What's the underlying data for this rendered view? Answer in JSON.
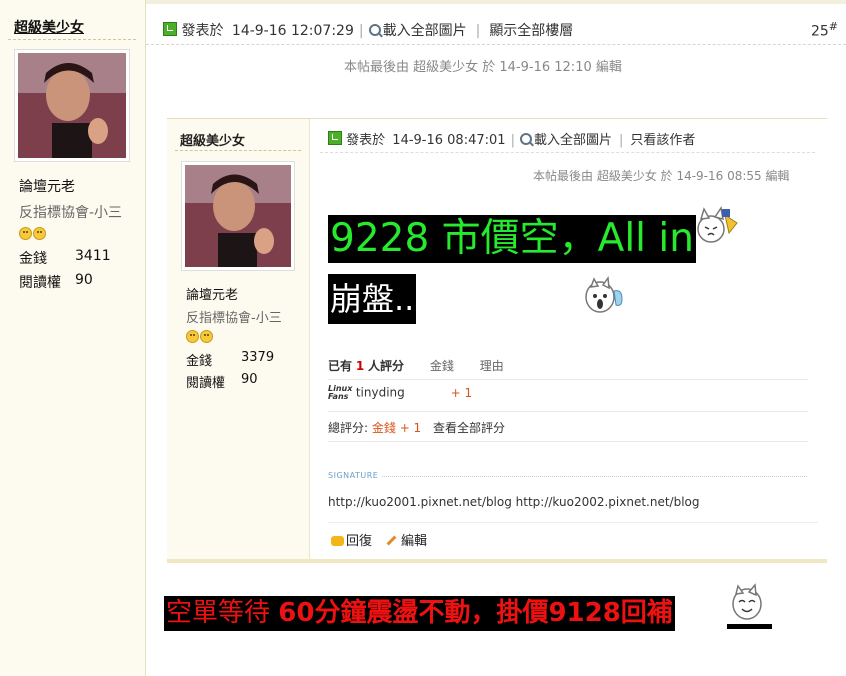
{
  "outer_user": {
    "username": "超級美少女",
    "rank": "論壇元老",
    "title": "反指標協會-小三",
    "stats": [
      {
        "label": "金錢",
        "value": "3411"
      },
      {
        "label": "閱讀權",
        "value": "90"
      }
    ]
  },
  "outer_post": {
    "posted_label": "發表於",
    "posted_time": "14-9-16 12:07:29",
    "load_images": "載入全部圖片",
    "show_all_floors": "顯示全部樓層",
    "floor_num": "25",
    "floor_mark": "#",
    "edit_note": "本帖最後由 超級美少女 於 14-9-16 12:10 編輯",
    "bottom_text_a": "空單等待 ",
    "bottom_text_b": "60分鐘震盪不動，掛價9128回補"
  },
  "inner_user": {
    "username": "超級美少女",
    "rank": "論壇元老",
    "title": "反指標協會-小三",
    "stats": [
      {
        "label": "金錢",
        "value": "3379"
      },
      {
        "label": "閱讀權",
        "value": "90"
      }
    ]
  },
  "inner_post": {
    "posted_label": "發表於",
    "posted_time": "14-9-16 08:47:01",
    "load_images": "載入全部圖片",
    "only_author": "只看該作者",
    "edit_note": "本帖最後由 超級美少女 於 14-9-16 08:55 編輯",
    "line1": "9228 市價空，All in",
    "line2": "崩盤..",
    "rating": {
      "header_prefix": "已有",
      "count": "1",
      "header_suffix": "人評分",
      "col_money": "金錢",
      "col_reason": "理由",
      "rater_badge_1": "Linux",
      "rater_badge_2": "Fans",
      "rater": "tinyding",
      "rater_value": "+ 1",
      "total_label": "總評分:",
      "total_value": "金錢 + 1",
      "view_all": "查看全部評分"
    },
    "signature_label": "SIGNATURE",
    "signature": "http://kuo2001.pixnet.net/blog http://kuo2002.pixnet.net/blog",
    "reply": "回復",
    "edit": "編輯"
  }
}
